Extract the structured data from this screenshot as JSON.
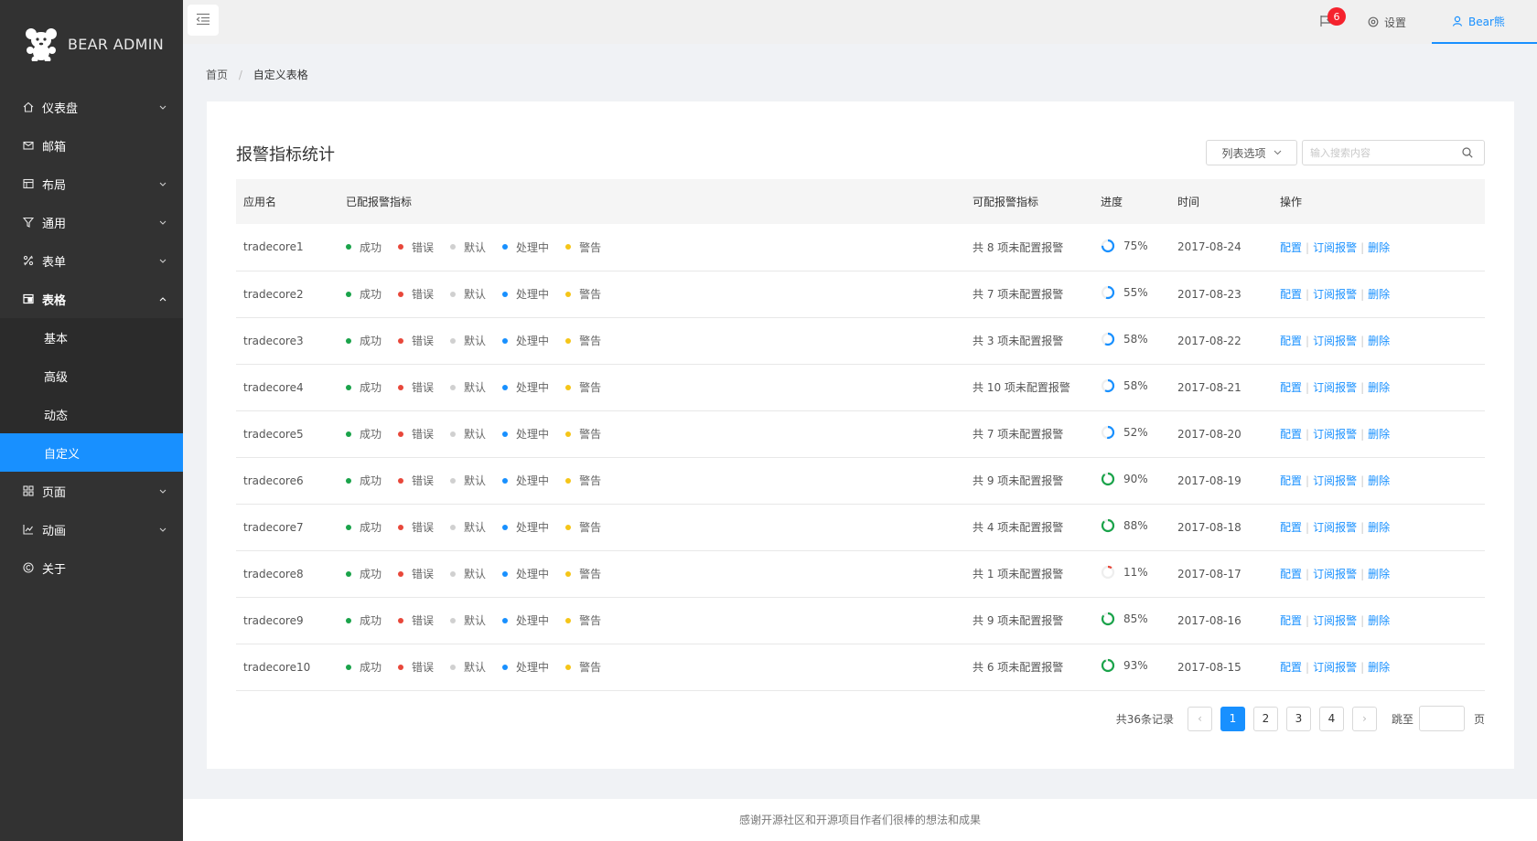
{
  "app": {
    "title": "BEAR ADMIN"
  },
  "sidebar": {
    "items": [
      {
        "label": "仪表盘",
        "icon": "home-icon",
        "arrow": "down"
      },
      {
        "label": "邮箱",
        "icon": "mail-icon",
        "arrow": ""
      },
      {
        "label": "布局",
        "icon": "layout-icon",
        "arrow": "down"
      },
      {
        "label": "通用",
        "icon": "filter-icon",
        "arrow": "down"
      },
      {
        "label": "表单",
        "icon": "form-icon",
        "arrow": "down"
      },
      {
        "label": "表格",
        "icon": "table-icon",
        "arrow": "up"
      },
      {
        "label": "页面",
        "icon": "grid-icon",
        "arrow": "down"
      },
      {
        "label": "动画",
        "icon": "chart-icon",
        "arrow": "down"
      },
      {
        "label": "关于",
        "icon": "copyright-icon",
        "arrow": ""
      }
    ],
    "table_submenu": [
      {
        "label": "基本"
      },
      {
        "label": "高级"
      },
      {
        "label": "动态"
      },
      {
        "label": "自定义"
      }
    ],
    "active_submenu": "自定义"
  },
  "header": {
    "notification_count": "6",
    "settings_label": "设置",
    "user_label": "Bear熊"
  },
  "breadcrumb": {
    "home": "首页",
    "separator": "/",
    "current": "自定义表格"
  },
  "card": {
    "title": "报警指标统计",
    "list_options_label": "列表选项",
    "search_placeholder": "输入搜索内容"
  },
  "table": {
    "columns": [
      "应用名",
      "已配报警指标",
      "可配报警指标",
      "进度",
      "时间",
      "操作"
    ],
    "status_labels": [
      {
        "label": "成功",
        "color": "#1aa34a"
      },
      {
        "label": "错误",
        "color": "#e8473a"
      },
      {
        "label": "默认",
        "color": "#d0d0d0"
      },
      {
        "label": "处理中",
        "color": "#1890ff"
      },
      {
        "label": "警告",
        "color": "#f5c518"
      }
    ],
    "actions": [
      "配置",
      "订阅报警",
      "删除"
    ],
    "rows": [
      {
        "app": "tradecore1",
        "available": "共 8 项未配置报警",
        "progress": 75,
        "progress_text": "75%",
        "date": "2017-08-24"
      },
      {
        "app": "tradecore2",
        "available": "共 7 项未配置报警",
        "progress": 55,
        "progress_text": "55%",
        "date": "2017-08-23"
      },
      {
        "app": "tradecore3",
        "available": "共 3 项未配置报警",
        "progress": 58,
        "progress_text": "58%",
        "date": "2017-08-22"
      },
      {
        "app": "tradecore4",
        "available": "共 10 项未配置报警",
        "progress": 58,
        "progress_text": "58%",
        "date": "2017-08-21"
      },
      {
        "app": "tradecore5",
        "available": "共 7 项未配置报警",
        "progress": 52,
        "progress_text": "52%",
        "date": "2017-08-20"
      },
      {
        "app": "tradecore6",
        "available": "共 9 项未配置报警",
        "progress": 90,
        "progress_text": "90%",
        "date": "2017-08-19"
      },
      {
        "app": "tradecore7",
        "available": "共 4 项未配置报警",
        "progress": 88,
        "progress_text": "88%",
        "date": "2017-08-18"
      },
      {
        "app": "tradecore8",
        "available": "共 1 项未配置报警",
        "progress": 11,
        "progress_text": "11%",
        "date": "2017-08-17"
      },
      {
        "app": "tradecore9",
        "available": "共 9 项未配置报警",
        "progress": 85,
        "progress_text": "85%",
        "date": "2017-08-16"
      },
      {
        "app": "tradecore10",
        "available": "共 6 项未配置报警",
        "progress": 93,
        "progress_text": "93%",
        "date": "2017-08-15"
      }
    ]
  },
  "pagination": {
    "total_text": "共36条记录",
    "pages": [
      "1",
      "2",
      "3",
      "4"
    ],
    "current_page": "1",
    "prev": "‹",
    "next": "›",
    "jump_label": "跳至",
    "jump_suffix": "页"
  },
  "footer": {
    "text": "感谢开源社区和开源项目作者们很棒的想法和成果"
  },
  "colors": {
    "accent": "#1890ff",
    "sidebar_bg": "#323232",
    "progress_blue": "#1890ff",
    "progress_green": "#1aa34a",
    "progress_red": "#e8473a"
  }
}
